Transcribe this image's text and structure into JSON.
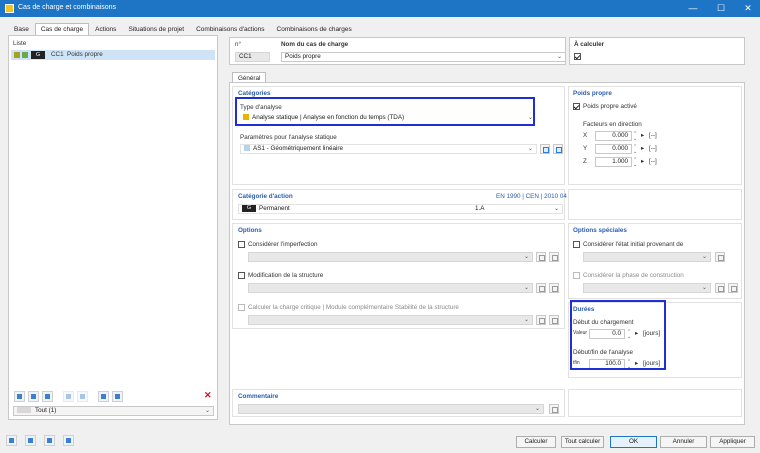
{
  "window": {
    "title": "Cas de charge et combinaisons",
    "minimize": "—",
    "maximize": "☐",
    "close": "✕"
  },
  "tabs": [
    "Base",
    "Cas de charge",
    "Actions",
    "Situations de projet",
    "Combinaisons d'actions",
    "Combinaisons de charges"
  ],
  "list": {
    "header": "Liste",
    "items": [
      {
        "badge": "G",
        "id": "CC1",
        "name": "Poids propre"
      }
    ],
    "filter": "Tout (1)",
    "delete_icon": "✕"
  },
  "top": {
    "no_label": "n°",
    "no_value": "CC1",
    "name_label": "Nom du cas de charge",
    "name_value": "Poids propre",
    "calc_label": "À calculer"
  },
  "subtab": "Général",
  "categories": {
    "header": "Catégories",
    "analysis_label": "Type d'analyse",
    "analysis_value": "Analyse statique | Analyse en fonction du temps (TDA)",
    "params_label": "Paramètres pour l'analyse statique",
    "params_value": "AS1 - Géométriquement linéaire"
  },
  "self_weight": {
    "header": "Poids propre",
    "active_label": "Poids propre activé",
    "factors_label": "Facteurs en direction",
    "rows": [
      {
        "axis": "X",
        "value": "0.000",
        "unit": "[--]"
      },
      {
        "axis": "Y",
        "value": "0.000",
        "unit": "[--]"
      },
      {
        "axis": "Z",
        "value": "1.000",
        "unit": "[--]"
      }
    ]
  },
  "action_category": {
    "header": "Catégorie d'action",
    "standard": "EN 1990 | CEN | 2010 04",
    "badge": "G",
    "value": "Permanent",
    "code": "1.A"
  },
  "options": {
    "header": "Options",
    "imperfection": "Considérer l'imperfection",
    "modification": "Modification de la structure",
    "critical": "Calculer la charge critique | Module complémentaire Stabilité de la structure"
  },
  "special_options": {
    "header": "Options spéciales",
    "initial_state": "Considérer l'état initial provenant de",
    "construction": "Considérer la phase de construction"
  },
  "durations": {
    "header": "Durées",
    "start_label": "Début du chargement",
    "start_prefix": "Valeur",
    "start_value": "0.0",
    "start_unit": "[jours]",
    "end_label": "Début/fin de l'analyse",
    "end_prefix": "tfin",
    "end_value": "100.0",
    "end_unit": "[jours]"
  },
  "comment": {
    "header": "Commentaire"
  },
  "buttons": {
    "calc": "Calculer",
    "calc_all": "Tout calculer",
    "ok": "OK",
    "cancel": "Annuler",
    "apply": "Appliquer"
  },
  "colors": {
    "accent": "#1e74c5",
    "header": "#2a5db0",
    "highlight": "#1f2fd8",
    "category_swatch": "#e8b400"
  }
}
